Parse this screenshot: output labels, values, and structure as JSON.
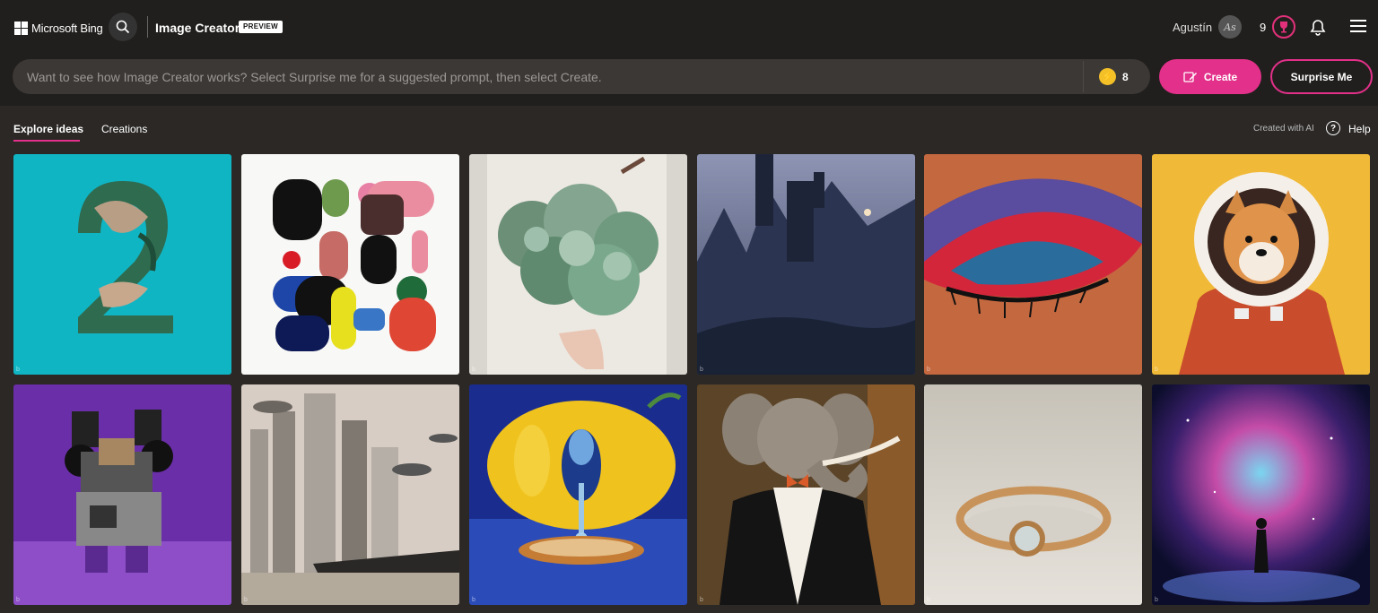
{
  "header": {
    "logo_text": "Microsoft Bing",
    "app_title": "Image Creator",
    "badge": "PREVIEW",
    "user_name": "Agustín",
    "avatar_initials": "As",
    "rewards_count": "9"
  },
  "prompt": {
    "placeholder": "Want to see how Image Creator works? Select Surprise me for a suggested prompt, then select Create.",
    "boosts": "8",
    "create_label": "Create",
    "surprise_label": "Surprise Me"
  },
  "tabs": [
    {
      "label": "Explore ideas",
      "active": true
    },
    {
      "label": "Creations",
      "active": false
    }
  ],
  "created_with": "Created with AI",
  "help_label": "Help",
  "accent_color": "#e3308a",
  "gallery": [
    {
      "subject": "number 2 made of leaves",
      "watermark": "b"
    },
    {
      "subject": "abstract colorful shapes",
      "watermark": "b"
    },
    {
      "subject": "succulent bouquet",
      "watermark": "b"
    },
    {
      "subject": "dark castle mountains",
      "watermark": "b"
    },
    {
      "subject": "colorful eye makeup",
      "watermark": "b"
    },
    {
      "subject": "shiba inu astronaut",
      "watermark": "b"
    },
    {
      "subject": "robot on purple",
      "watermark": "b"
    },
    {
      "subject": "futuristic city",
      "watermark": "b"
    },
    {
      "subject": "surreal lemon",
      "watermark": "b"
    },
    {
      "subject": "elephant in tuxedo",
      "watermark": "b"
    },
    {
      "subject": "opal ring",
      "watermark": "b"
    },
    {
      "subject": "galaxy figure",
      "watermark": "b"
    }
  ]
}
